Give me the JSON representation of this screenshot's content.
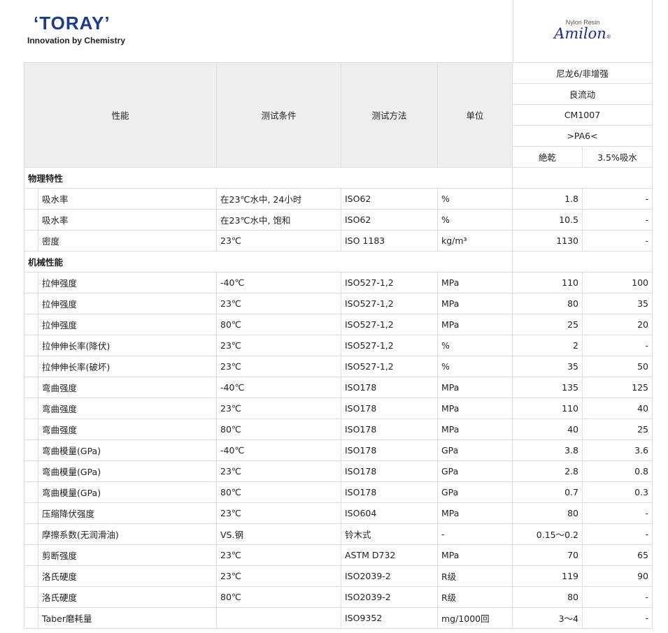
{
  "header": {
    "logo_text": "TORAY",
    "tagline": "Innovation by Chemistry",
    "product_line": "Nylon Resin",
    "brand": "Amilon"
  },
  "table": {
    "columns": {
      "property": "性能",
      "condition": "测试条件",
      "method": "测试方法",
      "unit": "单位"
    },
    "grade": {
      "type": "尼龙6/非增强",
      "feature": "良流动",
      "code": "CM1007",
      "marking": ">PA6<",
      "dry": "絶乾",
      "wet": "3.5%吸水"
    },
    "sections": [
      {
        "title": "物理特性",
        "rows": [
          {
            "p": "吸水率",
            "c": "在23℃水中, 24小时",
            "m": "ISO62",
            "u": "%",
            "d": "1.8",
            "w": "-"
          },
          {
            "p": "吸水率",
            "c": "在23℃水中, 饱和",
            "m": "ISO62",
            "u": "%",
            "d": "10.5",
            "w": "-"
          },
          {
            "p": "密度",
            "c": "23℃",
            "m": "ISO 1183",
            "u": "kg/m³",
            "d": "1130",
            "w": "-"
          }
        ]
      },
      {
        "title": "机械性能",
        "rows": [
          {
            "p": "拉伸强度",
            "c": "-40℃",
            "m": "ISO527-1,2",
            "u": "MPa",
            "d": "110",
            "w": "100"
          },
          {
            "p": "拉伸强度",
            "c": "23℃",
            "m": "ISO527-1,2",
            "u": "MPa",
            "d": "80",
            "w": "35"
          },
          {
            "p": "拉伸强度",
            "c": "80℃",
            "m": "ISO527-1,2",
            "u": "MPa",
            "d": "25",
            "w": "20"
          },
          {
            "p": "拉伸伸长率(降伏)",
            "c": "23℃",
            "m": "ISO527-1,2",
            "u": "%",
            "d": "2",
            "w": "-"
          },
          {
            "p": "拉伸伸长率(破坏)",
            "c": "23℃",
            "m": "ISO527-1,2",
            "u": "%",
            "d": "35",
            "w": "50"
          },
          {
            "p": "弯曲强度",
            "c": "-40℃",
            "m": "ISO178",
            "u": "MPa",
            "d": "135",
            "w": "125"
          },
          {
            "p": "弯曲强度",
            "c": "23℃",
            "m": "ISO178",
            "u": "MPa",
            "d": "110",
            "w": "40"
          },
          {
            "p": "弯曲强度",
            "c": "80℃",
            "m": "ISO178",
            "u": "MPa",
            "d": "40",
            "w": "25"
          },
          {
            "p": "弯曲模量(GPa)",
            "c": "-40℃",
            "m": "ISO178",
            "u": "GPa",
            "d": "3.8",
            "w": "3.6"
          },
          {
            "p": "弯曲模量(GPa)",
            "c": "23℃",
            "m": "ISO178",
            "u": "GPa",
            "d": "2.8",
            "w": "0.8"
          },
          {
            "p": "弯曲模量(GPa)",
            "c": "80℃",
            "m": "ISO178",
            "u": "GPa",
            "d": "0.7",
            "w": "0.3"
          },
          {
            "p": "压缩降伏强度",
            "c": "23℃",
            "m": "ISO604",
            "u": "MPa",
            "d": "80",
            "w": "-"
          },
          {
            "p": "摩擦系数(无润滑油)",
            "c": "VS.钢",
            "m": "铃木式",
            "u": "-",
            "d": "0.15～0.2",
            "w": "-"
          },
          {
            "p": "剪断强度",
            "c": "23℃",
            "m": "ASTM D732",
            "u": "MPa",
            "d": "70",
            "w": "65"
          },
          {
            "p": "洛氏硬度",
            "c": "23℃",
            "m": "ISO2039-2",
            "u": "R级",
            "d": "119",
            "w": "90"
          },
          {
            "p": "洛氏硬度",
            "c": "80℃",
            "m": "ISO2039-2",
            "u": "R级",
            "d": "80",
            "w": "-"
          },
          {
            "p": "Taber磨耗量",
            "c": "",
            "m": "ISO9352",
            "u": "mg/1000回",
            "d": "3～4",
            "w": "-"
          }
        ]
      }
    ]
  }
}
